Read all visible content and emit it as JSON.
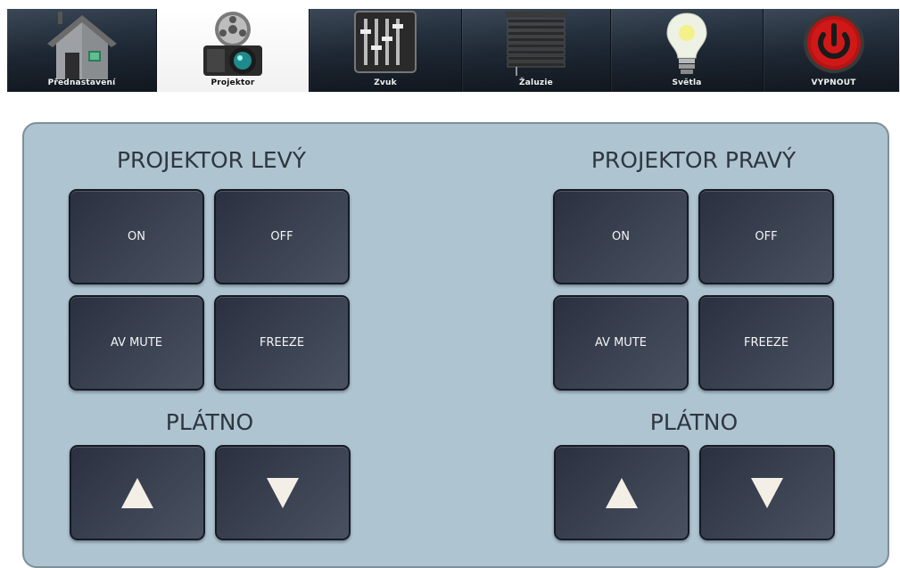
{
  "nav": {
    "items": [
      {
        "label": "Přednastavení",
        "icon": "house-icon",
        "active": false
      },
      {
        "label": "Projektor",
        "icon": "projector-icon",
        "active": true
      },
      {
        "label": "Zvuk",
        "icon": "audio-mixer-icon",
        "active": false
      },
      {
        "label": "Žaluzie",
        "icon": "blinds-icon",
        "active": false
      },
      {
        "label": "Světla",
        "icon": "light-bulb-icon",
        "active": false
      },
      {
        "label": "VYPNOUT",
        "icon": "power-icon",
        "active": false
      }
    ]
  },
  "left": {
    "title": "PROJEKTOR LEVÝ",
    "on_label": "ON",
    "off_label": "OFF",
    "avmute_label": "AV MUTE",
    "freeze_label": "FREEZE",
    "screen_title": "PLÁTNO"
  },
  "right": {
    "title": "PROJEKTOR PRAVÝ",
    "on_label": "ON",
    "off_label": "OFF",
    "avmute_label": "AV MUTE",
    "freeze_label": "FREEZE",
    "screen_title": "PLÁTNO"
  },
  "colors": {
    "panel_bg": "#aec4d1",
    "button_bg": "#3a4151",
    "nav_bg": "#1d2733",
    "power_red": "#d01818"
  }
}
